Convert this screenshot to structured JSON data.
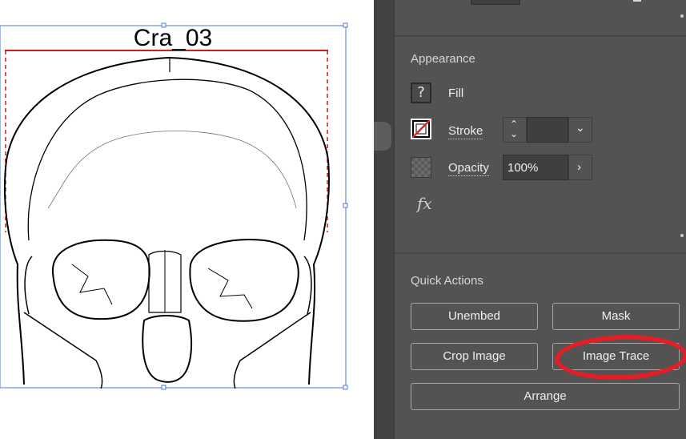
{
  "artboard": {
    "title": "Cra_03"
  },
  "panel": {
    "appearance": {
      "title": "Appearance",
      "fill_label": "Fill",
      "fill_icon": "unknown-fill-icon",
      "stroke_label": "Stroke",
      "stroke_icon": "no-stroke-icon",
      "opacity_label": "Opacity",
      "opacity_value": "100%",
      "fx_label": "fx"
    },
    "quick_actions": {
      "title": "Quick Actions",
      "buttons": [
        "Unembed",
        "Mask",
        "Crop Image",
        "Image Trace",
        "Arrange"
      ]
    }
  },
  "annotation": {
    "color": "#e21e26"
  }
}
